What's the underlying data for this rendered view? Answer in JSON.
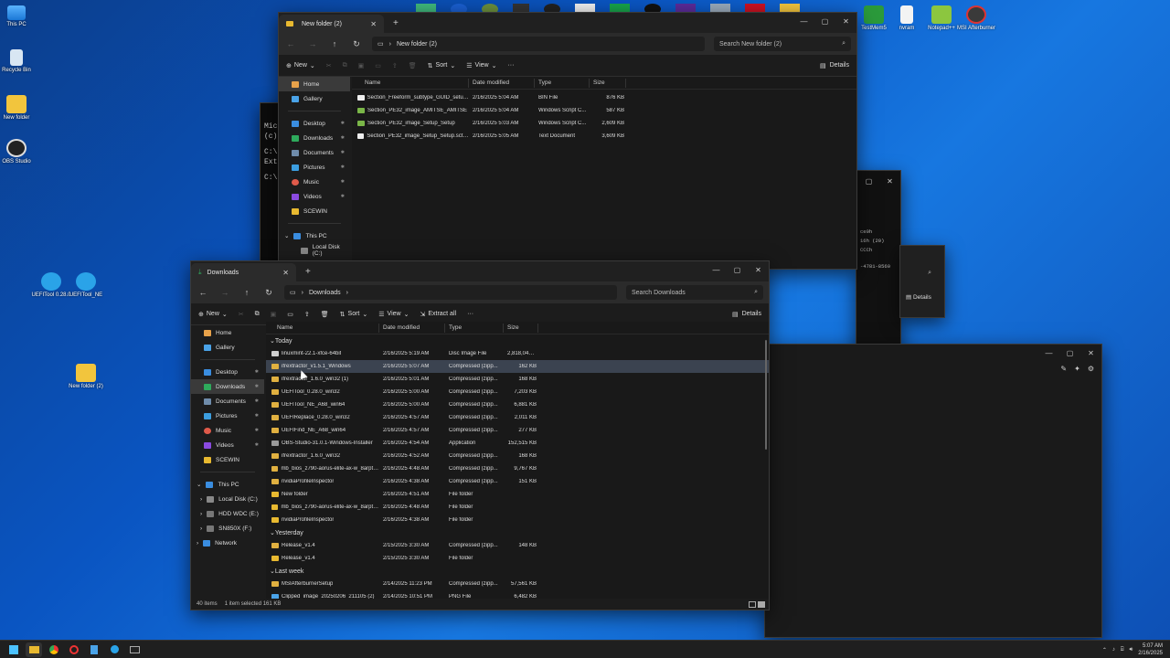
{
  "desktop": {
    "icons": [
      {
        "label": "This PC"
      },
      {
        "label": "Recycle Bin"
      },
      {
        "label": "New folder"
      },
      {
        "label": "OBS Studio"
      },
      {
        "label": "UEFITool 0.28.0"
      },
      {
        "label": "UEFITool_NE"
      },
      {
        "label": "New folder (2)"
      },
      {
        "label": "TestMem5"
      },
      {
        "label": "nvram"
      },
      {
        "label": "Notepad++"
      },
      {
        "label": "MSI Afterburner"
      }
    ]
  },
  "window_top": {
    "tab_title": "New folder (2)",
    "address": "New folder (2)",
    "search_placeholder": "Search New folder (2)",
    "cmd": {
      "new": "New",
      "sort": "Sort",
      "view": "View",
      "details": "Details"
    },
    "sidebar": [
      {
        "label": "Home"
      },
      {
        "label": "Gallery"
      },
      {
        "label": "Desktop"
      },
      {
        "label": "Downloads"
      },
      {
        "label": "Documents"
      },
      {
        "label": "Pictures"
      },
      {
        "label": "Music"
      },
      {
        "label": "Videos"
      },
      {
        "label": "SCEWIN"
      },
      {
        "label": "This PC"
      },
      {
        "label": "Local Disk (C:)"
      }
    ],
    "columns": {
      "name": "Name",
      "date": "Date modified",
      "type": "Type",
      "size": "Size"
    },
    "files": [
      {
        "name": "Section_Freeform_subtype_GUID_setupd...",
        "date": "2/16/2025 5:04 AM",
        "type": "BIN File",
        "size": "876 KB"
      },
      {
        "name": "Section_PE32_image_AMITSE_AMITSE",
        "date": "2/16/2025 5:04 AM",
        "type": "Windows Script C...",
        "size": "587 KB"
      },
      {
        "name": "Section_PE32_image_Setup_Setup",
        "date": "2/16/2025 5:03 AM",
        "type": "Windows Script C...",
        "size": "2,609 KB"
      },
      {
        "name": "Section_PE32_image_Setup_Setup.sct.0.0....",
        "date": "2/16/2025 5:05 AM",
        "type": "Text Document",
        "size": "3,609 KB"
      }
    ]
  },
  "bg_console": {
    "lines": [
      "Mic",
      "(c)",
      "C:\\",
      "Ext",
      "C:\\"
    ]
  },
  "bg_right_window": {
    "lines": [
      "ce0h",
      "16h (20)",
      "CCCh",
      "-4781-8560"
    ],
    "details": "Details"
  },
  "window_main": {
    "tab_title": "Downloads",
    "address": "Downloads",
    "search_placeholder": "Search Downloads",
    "cmd": {
      "new": "New",
      "sort": "Sort",
      "view": "View",
      "extract": "Extract all",
      "details": "Details"
    },
    "sidebar": [
      {
        "label": "Home"
      },
      {
        "label": "Gallery"
      },
      {
        "label": "Desktop"
      },
      {
        "label": "Downloads"
      },
      {
        "label": "Documents"
      },
      {
        "label": "Pictures"
      },
      {
        "label": "Music"
      },
      {
        "label": "Videos"
      },
      {
        "label": "SCEWIN"
      },
      {
        "label": "This PC"
      },
      {
        "label": "Local Disk (C:)"
      },
      {
        "label": "HDD WDC (E:)"
      },
      {
        "label": "SN850X (F:)"
      },
      {
        "label": "Network"
      }
    ],
    "columns": {
      "name": "Name",
      "date": "Date modified",
      "type": "Type",
      "size": "Size"
    },
    "groups": [
      {
        "label": "Today",
        "files": [
          {
            "name": "linuxmint-22.1-xfce-64bit",
            "date": "2/16/2025 5:19 AM",
            "type": "Disc Image File",
            "size": "2,818,048 KB",
            "icon": "disc"
          },
          {
            "name": "ifrextractor_v1.5.1_Windows",
            "date": "2/16/2025 5:07 AM",
            "type": "Compressed (zipp...",
            "size": "162 KB",
            "icon": "zip",
            "selected": true
          },
          {
            "name": "ifrextractor_1.6.0_win32 (1)",
            "date": "2/16/2025 5:01 AM",
            "type": "Compressed (zipp...",
            "size": "168 KB",
            "icon": "zip"
          },
          {
            "name": "UEFITool_0.28.0_win32",
            "date": "2/16/2025 5:00 AM",
            "type": "Compressed (zipp...",
            "size": "7,203 KB",
            "icon": "zip"
          },
          {
            "name": "UEFITool_NE_A68_win64",
            "date": "2/16/2025 5:00 AM",
            "type": "Compressed (zipp...",
            "size": "6,881 KB",
            "icon": "zip"
          },
          {
            "name": "UEFIReplace_0.28.0_win32",
            "date": "2/16/2025 4:57 AM",
            "type": "Compressed (zipp...",
            "size": "2,011 KB",
            "icon": "zip"
          },
          {
            "name": "UEFIFind_NE_A68_win64",
            "date": "2/16/2025 4:57 AM",
            "type": "Compressed (zipp...",
            "size": "277 KB",
            "icon": "zip"
          },
          {
            "name": "OBS-Studio-31.0.1-Windows-Installer",
            "date": "2/16/2025 4:54 AM",
            "type": "Application",
            "size": "152,515 KB",
            "icon": "app"
          },
          {
            "name": "ifrextractor_1.6.0_win32",
            "date": "2/16/2025 4:52 AM",
            "type": "Compressed (zipp...",
            "size": "168 KB",
            "icon": "zip"
          },
          {
            "name": "mb_bios_z790-aorus-elite-ax-w_8arpt074...",
            "date": "2/16/2025 4:48 AM",
            "type": "Compressed (zipp...",
            "size": "9,767 KB",
            "icon": "zip"
          },
          {
            "name": "nvidiaProfileInspector",
            "date": "2/16/2025 4:38 AM",
            "type": "Compressed (zipp...",
            "size": "151 KB",
            "icon": "zip"
          },
          {
            "name": "New folder",
            "date": "2/16/2025 4:51 AM",
            "type": "File folder",
            "size": "",
            "icon": "folder"
          },
          {
            "name": "mb_bios_z790-aorus-elite-ax-w_8arpt074...",
            "date": "2/16/2025 4:48 AM",
            "type": "File folder",
            "size": "",
            "icon": "folder"
          },
          {
            "name": "nvidiaProfileInspector",
            "date": "2/16/2025 4:38 AM",
            "type": "File folder",
            "size": "",
            "icon": "folder"
          }
        ]
      },
      {
        "label": "Yesterday",
        "files": [
          {
            "name": "Release_v1.4",
            "date": "2/15/2025 3:30 AM",
            "type": "Compressed (zipp...",
            "size": "148 KB",
            "icon": "zip"
          },
          {
            "name": "Release_v1.4",
            "date": "2/15/2025 3:30 AM",
            "type": "File folder",
            "size": "",
            "icon": "folder"
          }
        ]
      },
      {
        "label": "Last week",
        "files": [
          {
            "name": "MSIAfterburnerSetup",
            "date": "2/14/2025 11:23 PM",
            "type": "Compressed (zipp...",
            "size": "57,561 KB",
            "icon": "zip"
          },
          {
            "name": "Clipped_image_20250206_211105 (2)",
            "date": "2/14/2025 10:51 PM",
            "type": "PNG File",
            "size": "6,482 KB",
            "icon": "png"
          }
        ]
      }
    ],
    "status": {
      "count": "40 items",
      "selected": "1 item selected  161 KB"
    }
  },
  "taskbar": {
    "time": "5:07 AM",
    "date": "2/16/2025"
  },
  "colors": {
    "folder": "#e8b930",
    "zip": "#e0b040",
    "accent": "#4cc2ff",
    "selected_row": "#3b4350"
  }
}
